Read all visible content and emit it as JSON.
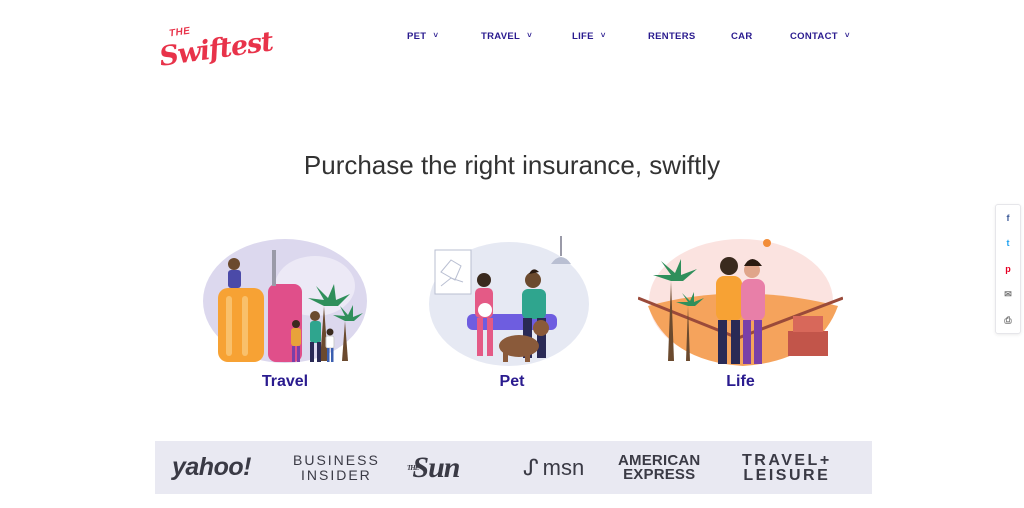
{
  "brand": {
    "logo_top": "THE",
    "logo_main": "Swiftest",
    "color": "#e8334a"
  },
  "nav": {
    "items": [
      {
        "label": "PET",
        "has_dropdown": true
      },
      {
        "label": "TRAVEL",
        "has_dropdown": true
      },
      {
        "label": "LIFE",
        "has_dropdown": true
      },
      {
        "label": "RENTERS",
        "has_dropdown": false
      },
      {
        "label": "CAR",
        "has_dropdown": false
      },
      {
        "label": "CONTACT",
        "has_dropdown": true
      }
    ],
    "chevron": "˅",
    "color": "#2a1b8f"
  },
  "hero": {
    "headline": "Purchase the right insurance, swiftly"
  },
  "cards": [
    {
      "label": "Travel",
      "illustration": "travel-illustration"
    },
    {
      "label": "Pet",
      "illustration": "pet-illustration"
    },
    {
      "label": "Life",
      "illustration": "life-illustration"
    }
  ],
  "social": [
    {
      "name": "facebook-icon",
      "glyph": "f",
      "color": "#3b5998"
    },
    {
      "name": "twitter-icon",
      "glyph": "t",
      "color": "#1da1f2"
    },
    {
      "name": "pinterest-icon",
      "glyph": "p",
      "color": "#e60023"
    },
    {
      "name": "email-icon",
      "glyph": "✉",
      "color": "#777777"
    },
    {
      "name": "print-icon",
      "glyph": "⎙",
      "color": "#777777"
    }
  ],
  "press": {
    "yahoo": "yahoo!",
    "business_insider": [
      "BUSINESS",
      "INSIDER"
    ],
    "the_sun": {
      "small": "THE",
      "main": "Sun"
    },
    "msn": {
      "bird": "ᔑ",
      "text": "msn"
    },
    "amex": [
      "AMERICAN",
      "EXPRESS"
    ],
    "travel_leisure": [
      "TRAVEL+",
      "LEISURE"
    ]
  }
}
